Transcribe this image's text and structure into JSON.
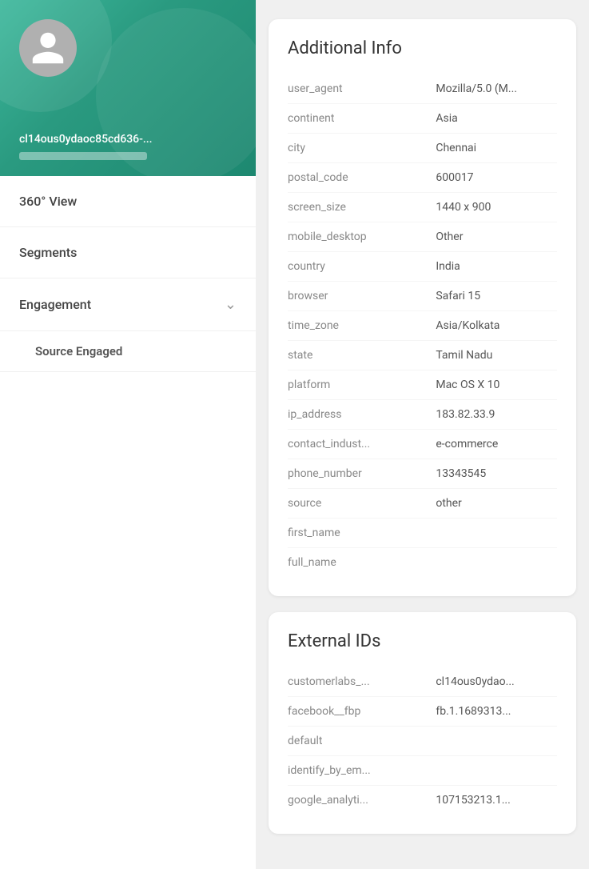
{
  "sidebar": {
    "user_id": "cl14ous0ydaoc85cd636-...",
    "nav_items": [
      {
        "id": "360-view",
        "label": "360° View",
        "expandable": false
      },
      {
        "id": "segments",
        "label": "Segments",
        "expandable": false
      },
      {
        "id": "engagement",
        "label": "Engagement",
        "expandable": true
      }
    ],
    "sub_items": [
      {
        "id": "source-engaged",
        "label": "Source Engaged"
      }
    ]
  },
  "additional_info": {
    "title": "Additional Info",
    "rows": [
      {
        "key": "user_agent",
        "value": "Mozilla/5.0 (M..."
      },
      {
        "key": "continent",
        "value": "Asia"
      },
      {
        "key": "city",
        "value": "Chennai"
      },
      {
        "key": "postal_code",
        "value": "600017"
      },
      {
        "key": "screen_size",
        "value": "1440 x 900"
      },
      {
        "key": "mobile_desktop",
        "value": "Other"
      },
      {
        "key": "country",
        "value": "India"
      },
      {
        "key": "browser",
        "value": "Safari 15"
      },
      {
        "key": "time_zone",
        "value": "Asia/Kolkata"
      },
      {
        "key": "state",
        "value": "Tamil Nadu"
      },
      {
        "key": "platform",
        "value": "Mac OS X 10"
      },
      {
        "key": "ip_address",
        "value": "183.82.33.9"
      },
      {
        "key": "contact_indust...",
        "value": "e-commerce"
      },
      {
        "key": "phone_number",
        "value": "13343545"
      },
      {
        "key": "source",
        "value": "other"
      },
      {
        "key": "first_name",
        "value": ""
      },
      {
        "key": "full_name",
        "value": ""
      }
    ]
  },
  "external_ids": {
    "title": "External IDs",
    "rows": [
      {
        "key": "customerlabs_...",
        "value": "cl14ous0ydao..."
      },
      {
        "key": "facebook__fbp",
        "value": "fb.1.1689313..."
      },
      {
        "key": "default",
        "value": ""
      },
      {
        "key": "identify_by_em...",
        "value": ""
      },
      {
        "key": "google_analyti...",
        "value": "107153213.1..."
      }
    ]
  }
}
